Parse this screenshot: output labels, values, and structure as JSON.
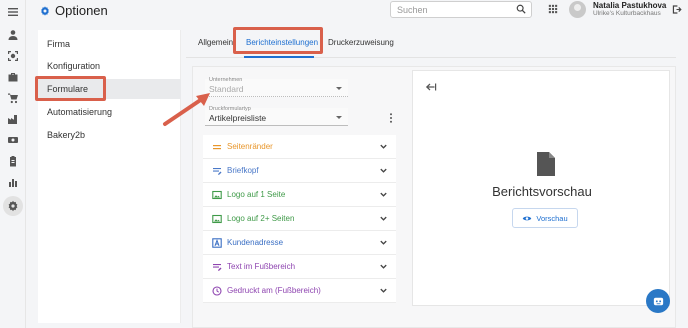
{
  "header": {
    "title": "Optionen",
    "search_placeholder": "Suchen",
    "user_name": "Natalia Pastukhova",
    "user_company": "Ulrike's Kulturbackhaus"
  },
  "rail": {
    "icons": [
      "menu-icon",
      "person-icon",
      "face-scan-icon",
      "briefcase-icon",
      "cart-icon",
      "factory-icon",
      "money-icon",
      "clipboard-icon",
      "chart-icon",
      "settings-icon"
    ]
  },
  "menu": {
    "items": [
      {
        "label": "Firma"
      },
      {
        "label": "Konfiguration"
      },
      {
        "label": "Formulare"
      },
      {
        "label": "Automatisierung"
      },
      {
        "label": "Bakery2b"
      }
    ]
  },
  "tabs": [
    {
      "label": "Allgemein"
    },
    {
      "label": "Berichteinstellungen"
    },
    {
      "label": "Druckerzuweisung"
    }
  ],
  "form": {
    "company_label": "Unternehmen",
    "company_value": "Standard",
    "type_label": "Druckformulartyp",
    "type_value": "Artikelpreisliste"
  },
  "sections": [
    {
      "label": "Seitenränder",
      "color": "#e8962b"
    },
    {
      "label": "Briefkopf",
      "color": "#4a78c8"
    },
    {
      "label": "Logo auf 1 Seite",
      "color": "#3f9a48"
    },
    {
      "label": "Logo auf 2+ Seiten",
      "color": "#3f9a48"
    },
    {
      "label": "Kundenadresse",
      "color": "#3a6fc4"
    },
    {
      "label": "Text im Fußbereich",
      "color": "#8e44b0"
    },
    {
      "label": "Gedruckt am (Fußbereich)",
      "color": "#8e44b0"
    }
  ],
  "preview": {
    "title": "Berichtsvorschau",
    "button_label": "Vorschau"
  },
  "colors": {
    "accent": "#1e6fd0",
    "highlight": "#d9604b"
  }
}
